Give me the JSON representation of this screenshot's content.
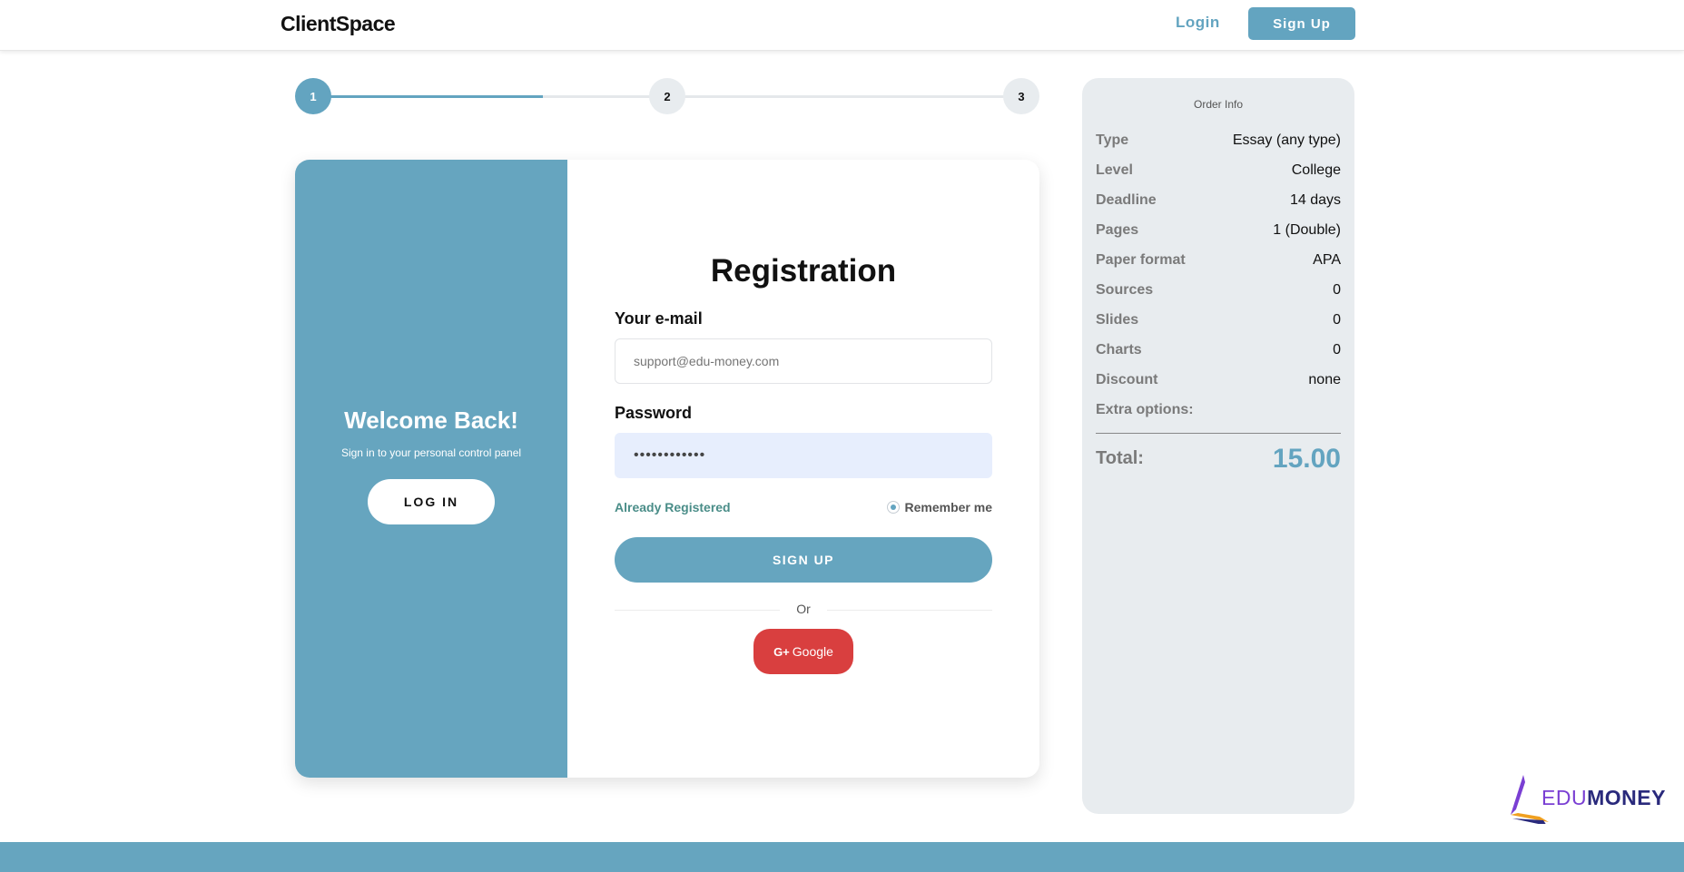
{
  "header": {
    "brand": "ClientSpace",
    "login_label": "Login",
    "signup_label": "Sign Up"
  },
  "stepper": {
    "steps": [
      "1",
      "2",
      "3"
    ],
    "current_step": 1,
    "progress_to_next": 0.6
  },
  "welcome_panel": {
    "title": "Welcome Back!",
    "subtitle": "Sign in to your personal control panel",
    "login_button": "LOG IN"
  },
  "registration": {
    "title": "Registration",
    "email_label": "Your e-mail",
    "email_placeholder": "support@edu-money.com",
    "email_value": "",
    "password_label": "Password",
    "password_value": "••••••••••••",
    "already_registered": "Already Registered",
    "remember_me": "Remember me",
    "remember_checked": true,
    "signup_button": "SIGN UP",
    "or_text": "Or",
    "google_icon": "G+",
    "google_button": "Google"
  },
  "order_info": {
    "title": "Order Info",
    "rows": [
      {
        "key": "Type",
        "value": "Essay (any type)"
      },
      {
        "key": "Level",
        "value": "College"
      },
      {
        "key": "Deadline",
        "value": "14 days"
      },
      {
        "key": "Pages",
        "value": "1 (Double)"
      },
      {
        "key": "Paper format",
        "value": "APA"
      },
      {
        "key": "Sources",
        "value": "0"
      },
      {
        "key": "Slides",
        "value": "0"
      },
      {
        "key": "Charts",
        "value": "0"
      },
      {
        "key": "Discount",
        "value": "none"
      },
      {
        "key": "Extra options:",
        "value": ""
      }
    ],
    "total_label": "Total:",
    "total_value": "15.00"
  },
  "logo": {
    "edu": "EDU",
    "money": "MONEY"
  },
  "colors": {
    "accent": "#63a4c0",
    "google": "#d93f3f",
    "panel_bg": "#e8ecef"
  }
}
